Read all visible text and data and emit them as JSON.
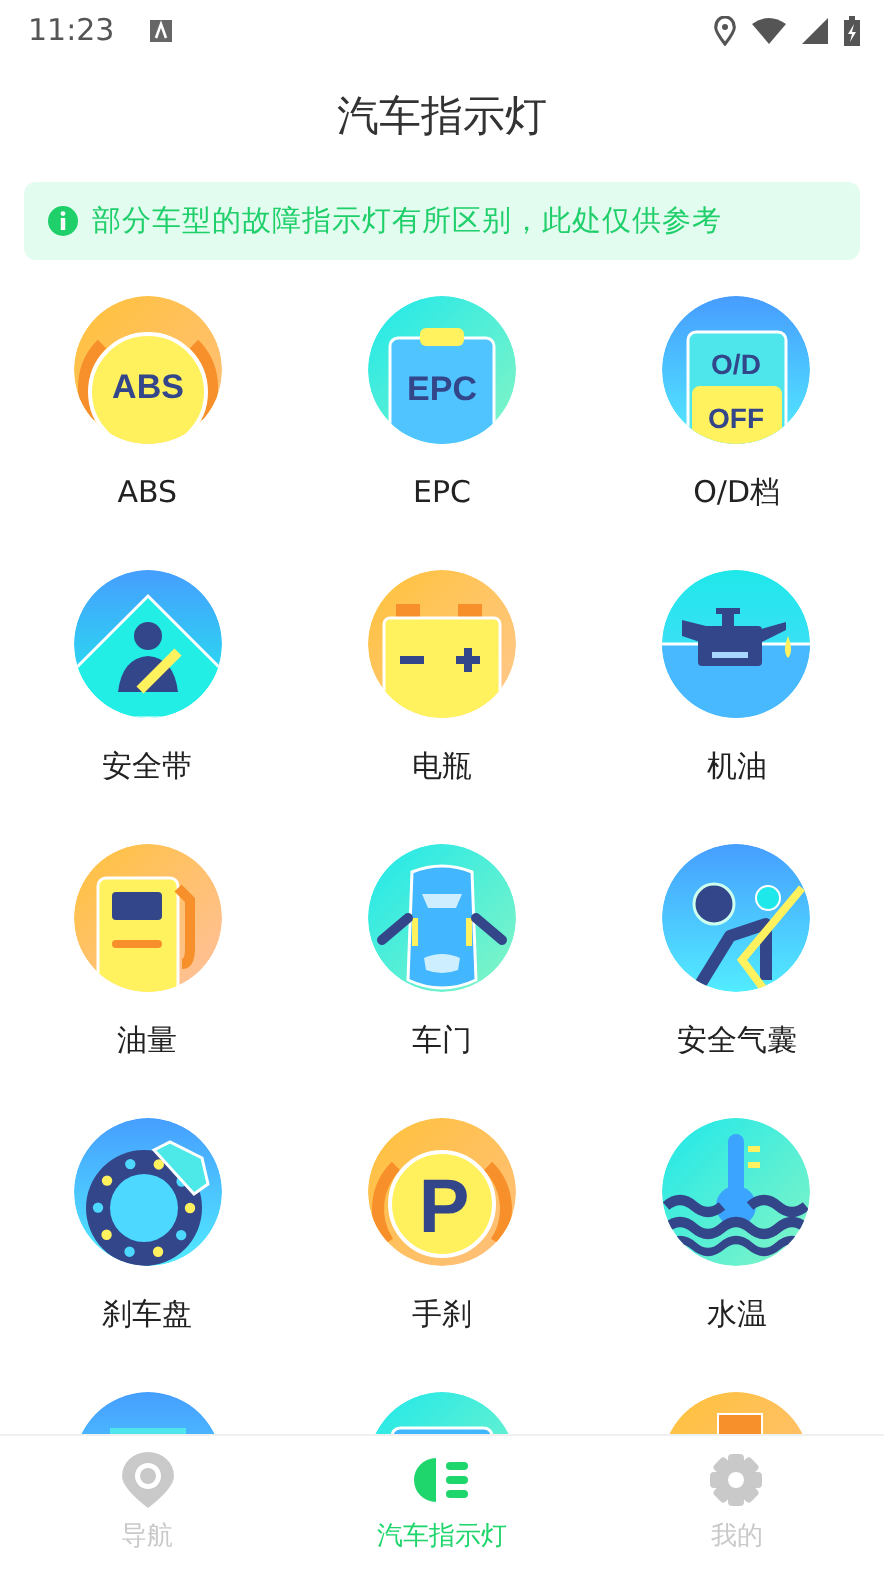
{
  "status_bar": {
    "time": "11:23"
  },
  "header": {
    "title": "汽车指示灯"
  },
  "notice": {
    "text": "部分车型的故障指示灯有所区别，此处仅供参考"
  },
  "lights": [
    {
      "kind": "abs",
      "label": "ABS",
      "icon_text": [
        "ABS"
      ]
    },
    {
      "kind": "epc",
      "label": "EPC",
      "icon_text": [
        "EPC"
      ]
    },
    {
      "kind": "od",
      "label": "O/D档",
      "icon_text": [
        "O/D",
        "OFF"
      ]
    },
    {
      "kind": "seatbelt",
      "label": "安全带"
    },
    {
      "kind": "battery",
      "label": "电瓶"
    },
    {
      "kind": "oil",
      "label": "机油"
    },
    {
      "kind": "fuel",
      "label": "油量"
    },
    {
      "kind": "door",
      "label": "车门"
    },
    {
      "kind": "airbag",
      "label": "安全气囊"
    },
    {
      "kind": "brake",
      "label": "刹车盘"
    },
    {
      "kind": "handbrake",
      "label": "手刹",
      "icon_text": [
        "P"
      ]
    },
    {
      "kind": "temperature",
      "label": "水温"
    },
    {
      "kind": "cropped_blue"
    },
    {
      "kind": "cropped_cyan"
    },
    {
      "kind": "cropped_orange"
    }
  ],
  "tabs": [
    {
      "kind": "pin",
      "label": "导航",
      "selected": false
    },
    {
      "kind": "headlight",
      "label": "汽车指示灯",
      "selected": true
    },
    {
      "kind": "gear",
      "label": "我的",
      "selected": false
    }
  ]
}
